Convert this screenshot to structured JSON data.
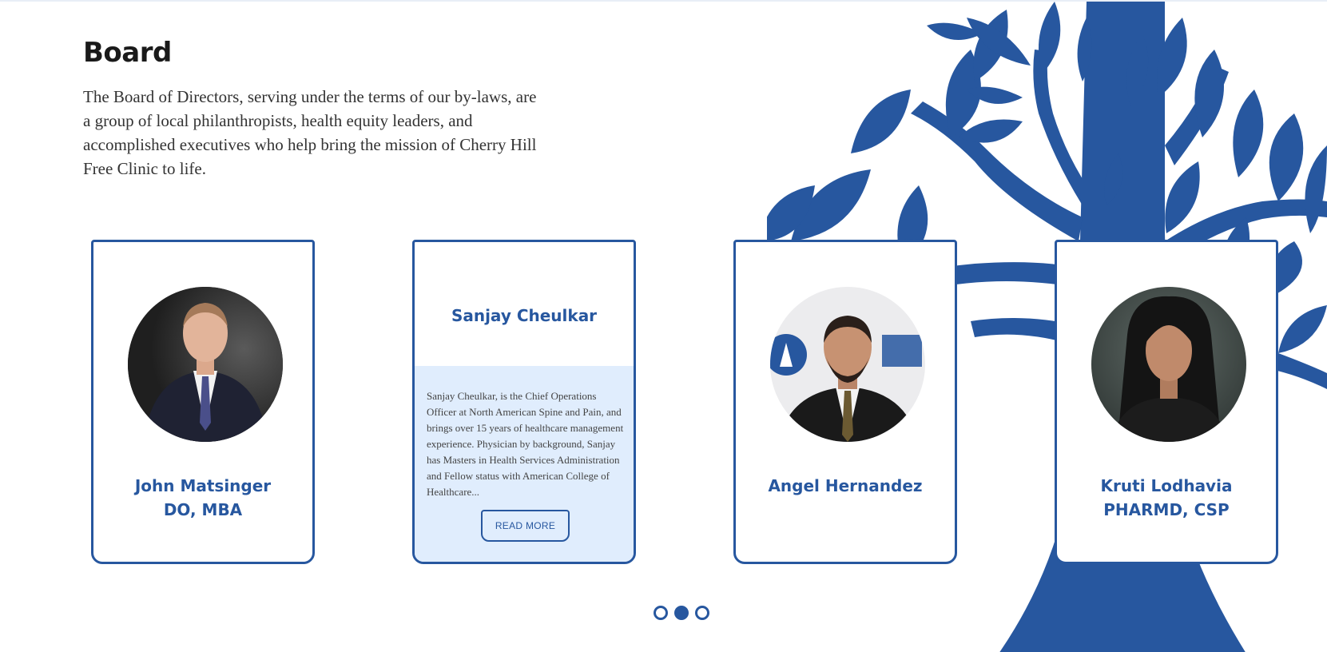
{
  "section": {
    "title": "Board",
    "description": "The Board of Directors, serving under the terms of our by-laws, are a group of local philanthropists, health equity leaders, and accomplished executives who help bring the mission of Cherry Hill Free Clinic to life."
  },
  "members": [
    {
      "name": "John Matsinger",
      "credentials": "DO, MBA"
    },
    {
      "name": "Sanjay Cheulkar",
      "bio": "Sanjay Cheulkar, is the Chief Operations Officer at North American Spine and Pain, and brings over 15 years of healthcare management experience. Physician by background, Sanjay has Masters in Health Services Administration and Fellow status with American College of Healthcare...",
      "read_more_label": "READ MORE"
    },
    {
      "name": "Angel Hernandez"
    },
    {
      "name": "Kruti Lodhavia",
      "credentials": "PHARMD, CSP"
    }
  ],
  "carousel": {
    "page_count": 3,
    "active_index": 1
  },
  "colors": {
    "brand_blue": "#27579f",
    "bio_panel": "#e0edfd",
    "heading": "#1a1a1a"
  },
  "icons": [
    "tree-illustration",
    "pagination-dot"
  ]
}
